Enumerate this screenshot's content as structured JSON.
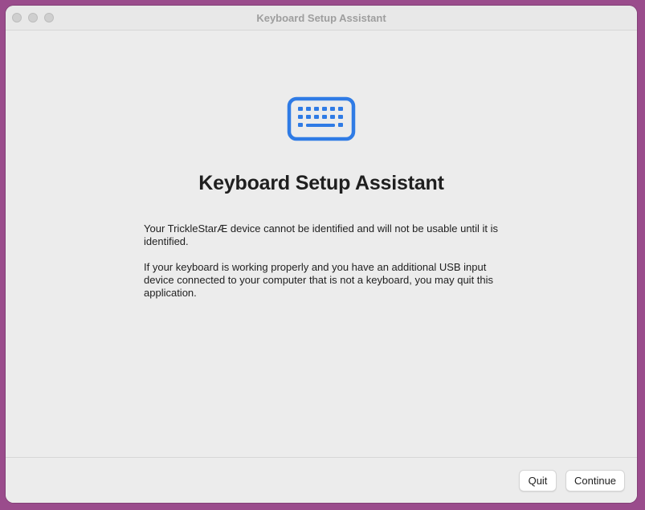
{
  "window": {
    "title": "Keyboard Setup Assistant"
  },
  "main": {
    "icon": "keyboard-icon",
    "heading": "Keyboard Setup Assistant",
    "paragraph1": "Your TrickleStarÆ device cannot be identified and will not be usable until it is identified.",
    "paragraph2": "If your keyboard is working properly and you have an additional USB input device connected to your computer that is not a keyboard, you may quit this application."
  },
  "footer": {
    "quit_label": "Quit",
    "continue_label": "Continue"
  },
  "colors": {
    "accent": "#2f7be5",
    "window_bg": "#ececec"
  }
}
